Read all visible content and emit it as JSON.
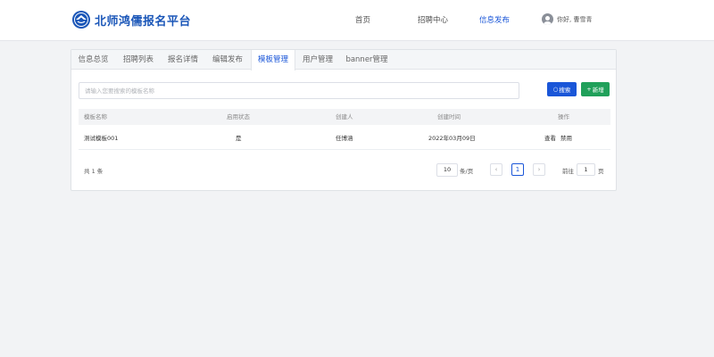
{
  "header": {
    "logo_text": "北师鸿儒报名平台",
    "nav": [
      "首页",
      "招聘中心",
      "信息发布"
    ],
    "active_nav": "信息发布",
    "user_greeting": "你好, 曹雪青"
  },
  "tabs": [
    "信息总览",
    "招聘列表",
    "报名详情",
    "编辑发布",
    "模板管理",
    "用户管理",
    "banner管理"
  ],
  "active_tab": "模板管理",
  "search": {
    "placeholder": "请输入您要搜索的模板名称",
    "search_label": "搜索",
    "add_label": "新增"
  },
  "table": {
    "headers": [
      "模板名称",
      "启用状态",
      "创建人",
      "创建时间",
      "操作"
    ],
    "rows": [
      {
        "name": "测试模板001",
        "status": "是",
        "creator": "任博涵",
        "created": "2022年03月09日",
        "actions": [
          "查看",
          "禁用"
        ]
      }
    ]
  },
  "pagination": {
    "total_text": "共 1 条",
    "page_size": "10",
    "page_size_unit": "条/页",
    "prev": "‹",
    "current_page": "1",
    "next": "›",
    "goto_label": "前往",
    "goto_value": "1",
    "goto_unit": "页"
  },
  "colors": {
    "primary": "#1a56d8",
    "success": "#20a05a"
  }
}
